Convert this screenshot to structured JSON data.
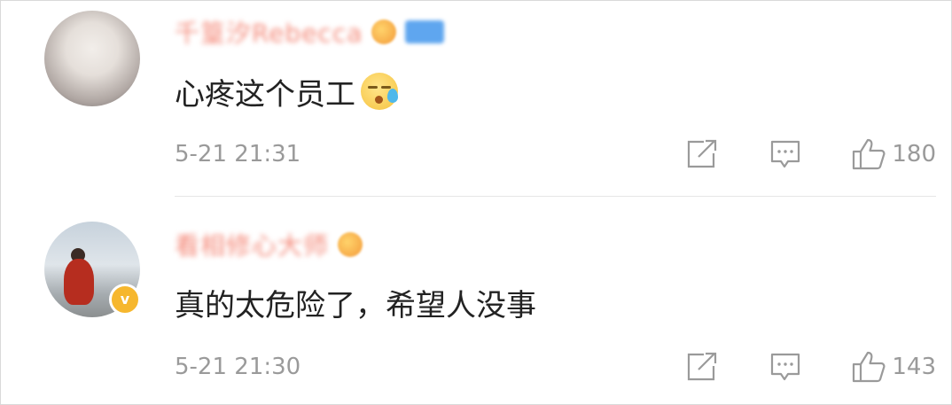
{
  "comments": [
    {
      "username": "千篁汐Rebecca",
      "text": "心疼这个员工",
      "emoji": "sweat-face-emoji",
      "time": "5-21 21:31",
      "likes": "180",
      "has_level_badge": true,
      "has_verified_badge": false
    },
    {
      "username": "看相修心大师",
      "text": "真的太危险了，希望人没事",
      "emoji": null,
      "time": "5-21 21:30",
      "likes": "143",
      "has_level_badge": false,
      "has_verified_badge": true
    }
  ],
  "icons": {
    "repost": "repost-icon",
    "reply": "reply-icon",
    "like": "thumbs-up-icon"
  },
  "colors": {
    "username": "#f48a7a",
    "meta_text": "#9a9a9a",
    "body_text": "#222222",
    "verified_badge": "#f6b72e"
  }
}
